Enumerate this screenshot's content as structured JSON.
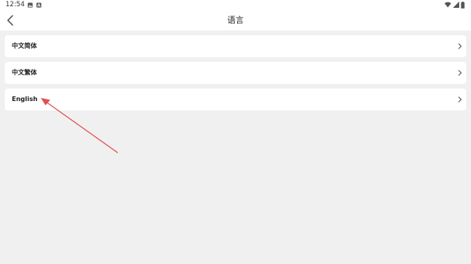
{
  "status_bar": {
    "time": "12:54",
    "left_icons": [
      "image-icon",
      "a-badge-icon"
    ],
    "right_icons": [
      "wifi-icon",
      "signal-icon",
      "battery-icon"
    ]
  },
  "header": {
    "title": "语言",
    "back_icon": "chevron-left-icon"
  },
  "languages": [
    {
      "label": "中文简体"
    },
    {
      "label": "中文繁体"
    },
    {
      "label": "English"
    }
  ],
  "annotation": {
    "type": "arrow",
    "color": "#e05050"
  }
}
